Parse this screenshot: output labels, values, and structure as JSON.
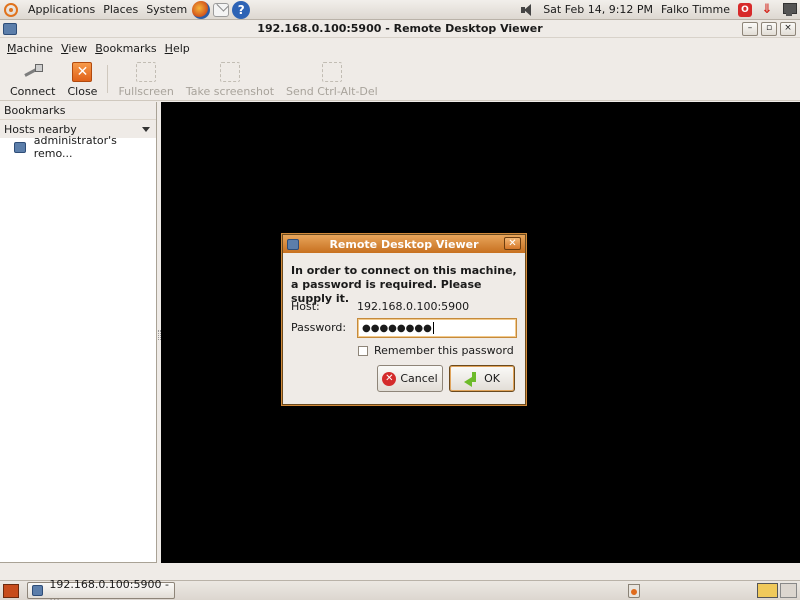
{
  "top_panel": {
    "menus": [
      "Applications",
      "Places",
      "System"
    ],
    "clock": "Sat Feb 14,  9:12 PM",
    "user": "Falko Timme"
  },
  "window": {
    "title": "192.168.0.100:5900 - Remote Desktop Viewer",
    "min_glyph": "–",
    "max_glyph": "▫",
    "close_glyph": "×"
  },
  "menubar": [
    {
      "label": "Machine",
      "mnemonic": "M",
      "rest": "achine"
    },
    {
      "label": "View",
      "mnemonic": "V",
      "rest": "iew"
    },
    {
      "label": "Bookmarks",
      "mnemonic": "B",
      "rest": "ookmarks"
    },
    {
      "label": "Help",
      "mnemonic": "H",
      "rest": "elp"
    }
  ],
  "toolbar": {
    "connect": "Connect",
    "close": "Close",
    "fullscreen": "Fullscreen",
    "screenshot": "Take screenshot",
    "send_cad": "Send Ctrl-Alt-Del"
  },
  "sidebar": {
    "heading": "Bookmarks",
    "section": "Hosts nearby",
    "hosts": [
      "administrator's remo..."
    ]
  },
  "dialog": {
    "title": "Remote Desktop Viewer",
    "message": "In order to connect on this machine, a password is required. Please supply it.",
    "host_label": "Host:",
    "host_value": "192.168.0.100:5900",
    "password_label": "Password:",
    "password_mask": "●●●●●●●●",
    "remember_label": "Remember this password",
    "remember_checked": false,
    "cancel_label": "Cancel",
    "ok_label": "OK"
  },
  "taskbar": {
    "task_label": "192.168.0.100:5900 - ..."
  },
  "colors": {
    "dialog_title_bar": "#d07e2c",
    "remote_view": "#000000",
    "panel": "#e6e1db"
  }
}
